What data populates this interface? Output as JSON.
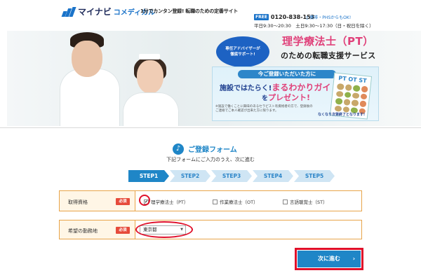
{
  "header": {
    "brand": "マイナビ",
    "brand_sub": "コメディカル",
    "tagline": "1分でカンタン登録! 転職のための定番サイト",
    "free_badge": "FREE",
    "phone": "0120-838-153",
    "mobile_note": "携帯・PHSからもOK!",
    "hours": "平日9:30〜20:30　土日9:30〜17:30（日・祝日を除く）"
  },
  "banner": {
    "advisor_line1": "専任アドバイザーが",
    "advisor_line2": "徹底サポート!",
    "title": "理学療法士（PT）",
    "subtitle": "のための転職支援サービス",
    "promo_line1": "今ご登録いただいた方に",
    "promo_line2_a": "施設ではたらく!",
    "promo_line2_b": "まるわかりガイド",
    "promo_line3_a": "を",
    "promo_line3_b": "プレゼント!",
    "promo_note": "※施設で働くことに興味のあるセラピスト有資格者の方で、登録後のご連絡でご本人確認が出来た方に限ります。",
    "book_title": "PT OT ST",
    "ribbon": "なくなり次第終了となります!"
  },
  "form": {
    "title": "ご登録フォーム",
    "instruction": "下記フォームにご入力のうえ、次に進む",
    "steps": [
      "STEP1",
      "STEP2",
      "STEP3",
      "STEP4",
      "STEP5"
    ],
    "qualification": {
      "label": "取得資格",
      "required": "必須",
      "options": [
        {
          "label": "理学療法士（PT）",
          "checked": true
        },
        {
          "label": "作業療法士（OT）",
          "checked": false
        },
        {
          "label": "言語聴覚士（ST）",
          "checked": false
        }
      ]
    },
    "location": {
      "label": "希望の勤務地",
      "required": "必須",
      "selected": "東京都"
    },
    "next_label": "次に進む",
    "next_arrow": "›"
  },
  "colors": {
    "accent_blue": "#1f86c7",
    "highlight_red": "#e0102a",
    "row_border": "#e8a44a",
    "title_pink": "#e0417a"
  }
}
